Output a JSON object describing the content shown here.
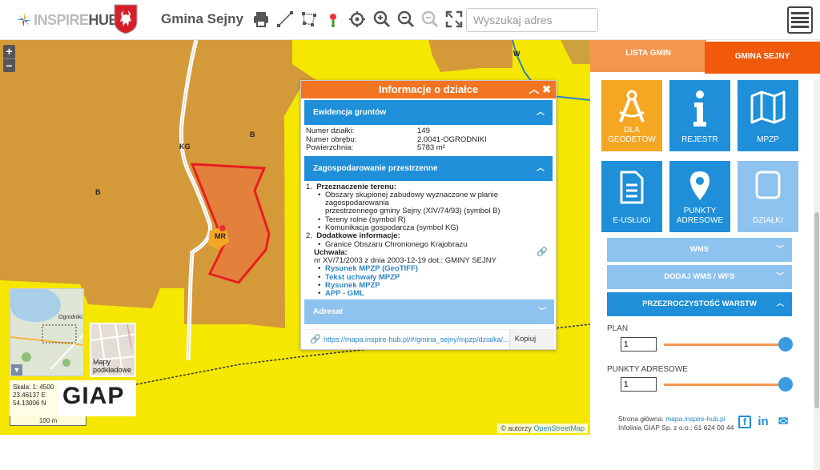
{
  "header": {
    "logo_text_1": "INSPIRE",
    "logo_text_2": "HUB",
    "gmina_title": "Gmina Sejny",
    "search_placeholder": "Wyszukaj adres",
    "tools": [
      "print-icon",
      "measure-line-icon",
      "measure-area-icon",
      "location-pin-icon",
      "crosshair-icon",
      "zoom-in-icon",
      "zoom-out-icon",
      "zoom-disabled-icon",
      "fullscreen-icon"
    ]
  },
  "map": {
    "labels": {
      "b1": "B",
      "b2": "B",
      "kg": "KG",
      "mr": "MR",
      "w": "W"
    },
    "zoom_in": "+",
    "zoom_out": "−",
    "minimap_label": "Ogrodniki",
    "mapy_label": "Mapy podkładowe",
    "scale": "Skala: 1: 4500",
    "coord_e": "23.46137 E",
    "coord_n": "54.13006 N",
    "giap": "GIAP",
    "scale_bar": "100 m",
    "attribution": "© autorzy",
    "attribution_link": "OpenStreetMap"
  },
  "popup": {
    "title": "Informacje o działce",
    "section_ewidencja": "Ewidencja gruntów",
    "rows": [
      {
        "key": "Numer działki:",
        "value": "149"
      },
      {
        "key": "Numer obrębu:",
        "value": "2.0041-OGRODNIKI"
      },
      {
        "key": "Powierzchnia:",
        "value": "5783 m²"
      }
    ],
    "section_zagosp": "Zagospodarowanie przestrzenne",
    "przeznaczenie_title": "Przeznaczenie terenu:",
    "przeznaczenie_items": [
      "Obszary skupionej zabudowy wyznaczone w planie zagospodarowania",
      "przestrzennego gminy Sejny (XIV/74/93) (symbol B)",
      "Tereny rolne (symbol R)",
      "Komunikacja gospodarcza (symbol KG)"
    ],
    "dodatkowe_title": "Dodatkowe informacje:",
    "dodatkowe_item": "Granice Obszaru Chronionego Krajobrazu",
    "uchwala_label": "Uchwała:",
    "uchwala_text": "nr XV/71/2003 z dnia 2003-12-19 dot.: GMINY SEJNY",
    "links": [
      "Rysunek MPZP (GeoTIFF)",
      "Tekst uchwały MPZP",
      "Rysunek MPZP",
      "APP - GML"
    ],
    "section_adresat": "Adresat",
    "url": "https://mapa.inspire-hub.pl/#/gmina_sejny/mpzp/dzialka/...",
    "copy_label": "Kopiuj link"
  },
  "sidebar": {
    "tab_lista": "LISTA GMIN",
    "tab_gmina": "GMINA SEJNY",
    "tiles": [
      {
        "label": "DLA GEODETÓW",
        "icon": "compass-icon"
      },
      {
        "label": "REJESTR",
        "icon": "info-icon"
      },
      {
        "label": "MPZP",
        "icon": "map-icon"
      },
      {
        "label": "E-USŁUGI",
        "icon": "document-icon"
      },
      {
        "label": "PUNKTY ADRESOWE",
        "icon": "location-icon"
      },
      {
        "label": "DZIAŁKI",
        "icon": "parcel-icon"
      }
    ],
    "bars": [
      "WMS",
      "DODAJ WMS / WFS",
      "PRZEZROCZYSTOŚĆ WARSTW"
    ],
    "plan_label": "PLAN",
    "plan_value": "1",
    "punkty_label": "PUNKTY ADRESOWE",
    "punkty_value": "1",
    "footer_line1_prefix": "Strona główna:",
    "footer_line1_link": "mapa.inspire-hub.pl",
    "footer_line2": "Infolinia GIAP Sp. z o.o.: 61 624 00 44",
    "social": [
      "f",
      "in",
      "✉"
    ]
  },
  "colors": {
    "accent_orange": "#f05a0a",
    "accent_blue": "#1e8fd8",
    "map_yellow": "#f5e700",
    "map_brown": "#d49a3a"
  }
}
